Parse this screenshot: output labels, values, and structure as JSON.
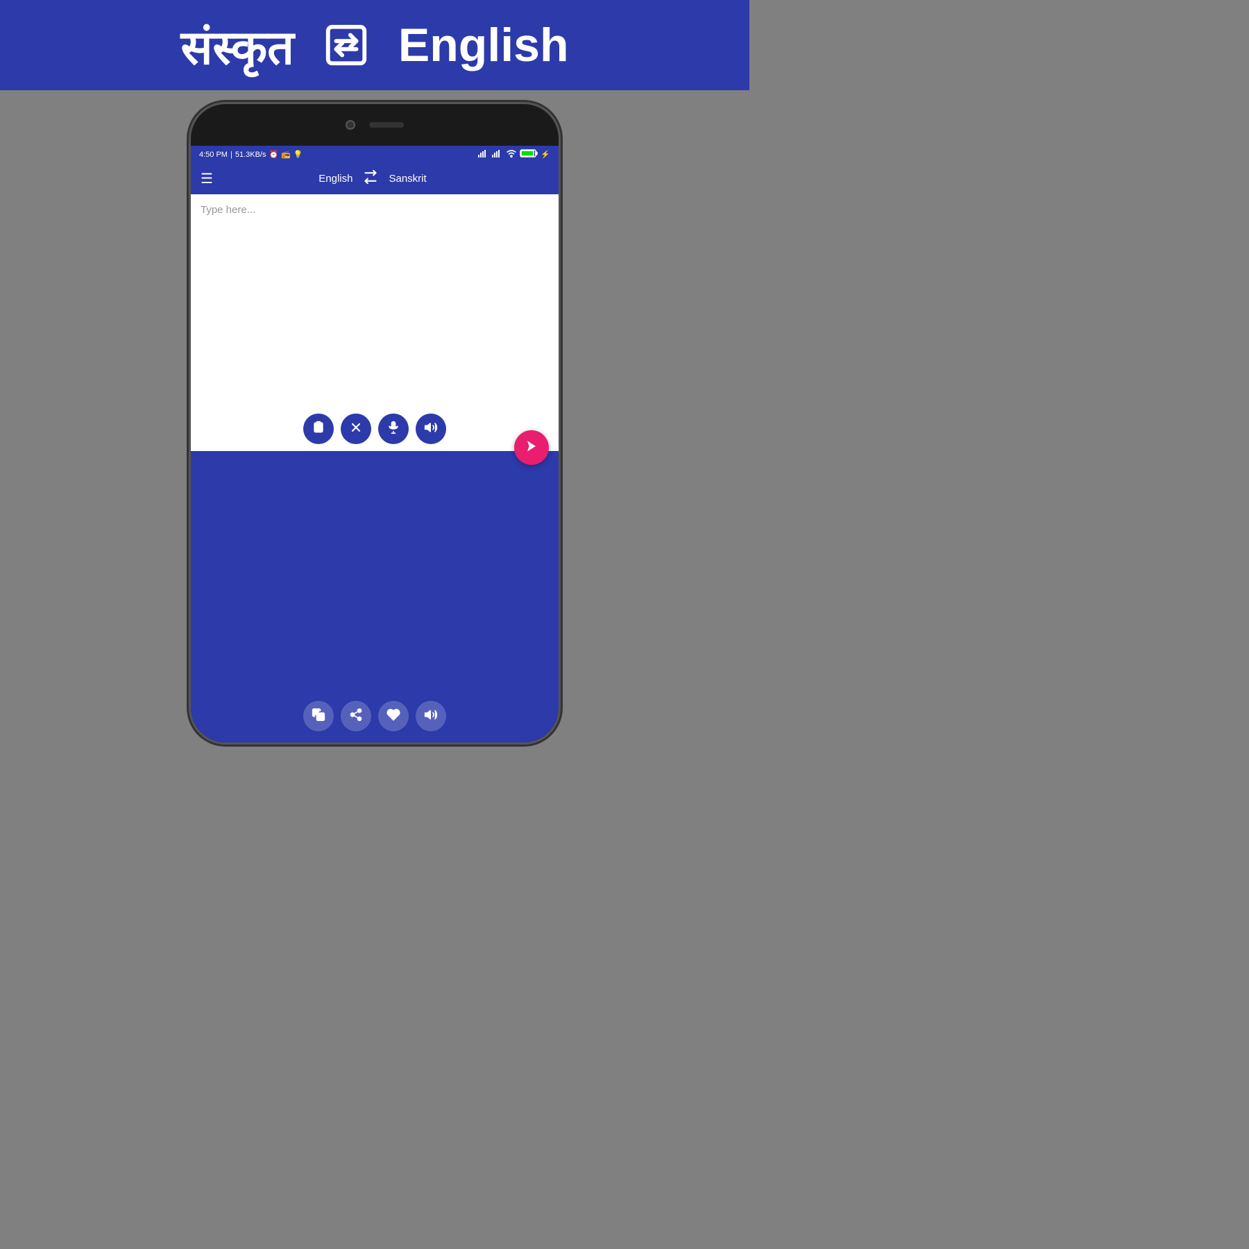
{
  "banner": {
    "source_lang": "संस्कृत",
    "target_lang": "English"
  },
  "status_bar": {
    "time": "4:50 PM",
    "network_speed": "51.3KB/s"
  },
  "app_bar": {
    "source_lang": "English",
    "target_lang": "Sanskrit"
  },
  "input": {
    "placeholder": "Type here..."
  },
  "toolbar_buttons": {
    "clipboard": "clipboard",
    "close": "close",
    "mic": "mic",
    "volume": "volume"
  },
  "output_toolbar_buttons": {
    "copy": "copy",
    "share": "share",
    "favorite": "favorite",
    "volume": "volume"
  }
}
